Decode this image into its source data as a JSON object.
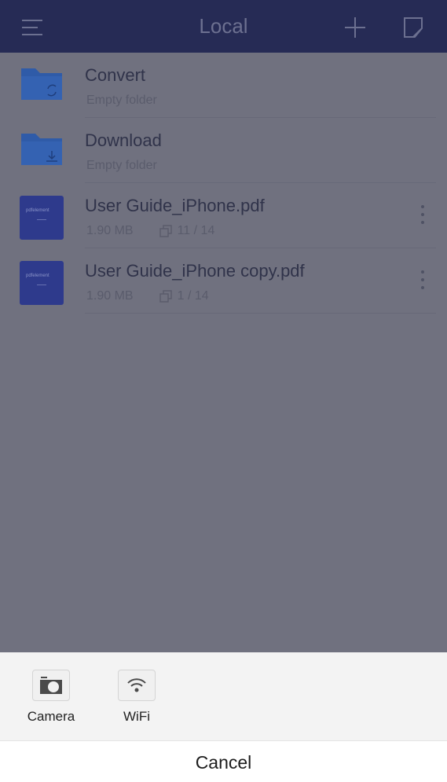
{
  "navbar": {
    "title": "Local",
    "menu_icon": "hamburger-menu-icon",
    "add_icon": "plus-icon",
    "edit_icon": "edit-note-icon"
  },
  "files": [
    {
      "type": "folder",
      "name": "Convert",
      "subtitle": "Empty folder",
      "icon": "folder-convert-icon"
    },
    {
      "type": "folder",
      "name": "Download",
      "subtitle": "Empty folder",
      "icon": "folder-download-icon"
    },
    {
      "type": "pdf",
      "name": "User Guide_iPhone.pdf",
      "size": "1.90 MB",
      "pages": "11 / 14",
      "thumb_brand": "pdfelement",
      "icon": "pdf-thumbnail"
    },
    {
      "type": "pdf",
      "name": "User Guide_iPhone copy.pdf",
      "size": "1.90 MB",
      "pages": "1 / 14",
      "thumb_brand": "pdfelement",
      "icon": "pdf-thumbnail"
    }
  ],
  "sheet": {
    "options": [
      {
        "label": "Camera",
        "icon": "camera-icon"
      },
      {
        "label": "WiFi",
        "icon": "wifi-icon"
      }
    ],
    "cancel_label": "Cancel"
  },
  "colors": {
    "navbar_bg": "#262b55",
    "overlay_bg": "#70717f",
    "folder_blue": "#2f5ba8",
    "pdf_thumb_bg": "#2e3a8c",
    "sheet_bg": "#f3f3f3"
  }
}
